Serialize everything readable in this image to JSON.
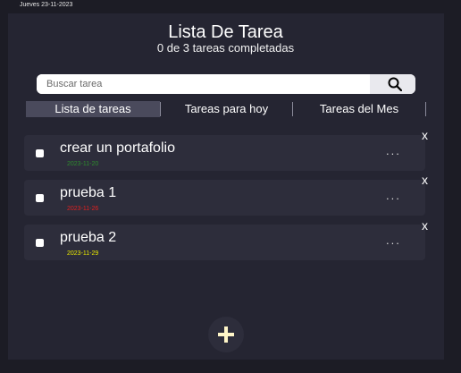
{
  "header": {
    "date": "Jueves 23-11-2023",
    "title": "Lista De Tarea",
    "subtitle": "0 de 3 tareas completadas"
  },
  "search": {
    "placeholder": "Buscar tarea",
    "value": "",
    "icon": "search-icon"
  },
  "tabs": [
    {
      "label": "Lista de tareas",
      "active": true
    },
    {
      "label": "Tareas para hoy",
      "active": false
    },
    {
      "label": "Tareas del Mes",
      "active": false
    }
  ],
  "tasks": [
    {
      "name": "crear un portafolio",
      "date": "2023-11-20",
      "date_color": "#2e8b2e",
      "completed": false,
      "more": "...",
      "delete": "x"
    },
    {
      "name": "prueba 1",
      "date": "2023-11-26",
      "date_color": "#e02020",
      "completed": false,
      "more": "...",
      "delete": "x"
    },
    {
      "name": "prueba 2",
      "date": "2023-11-29",
      "date_color": "#e8e800",
      "completed": false,
      "more": "...",
      "delete": "x"
    }
  ],
  "add_button": {
    "icon": "plus-icon",
    "color": "#fff6c8"
  }
}
